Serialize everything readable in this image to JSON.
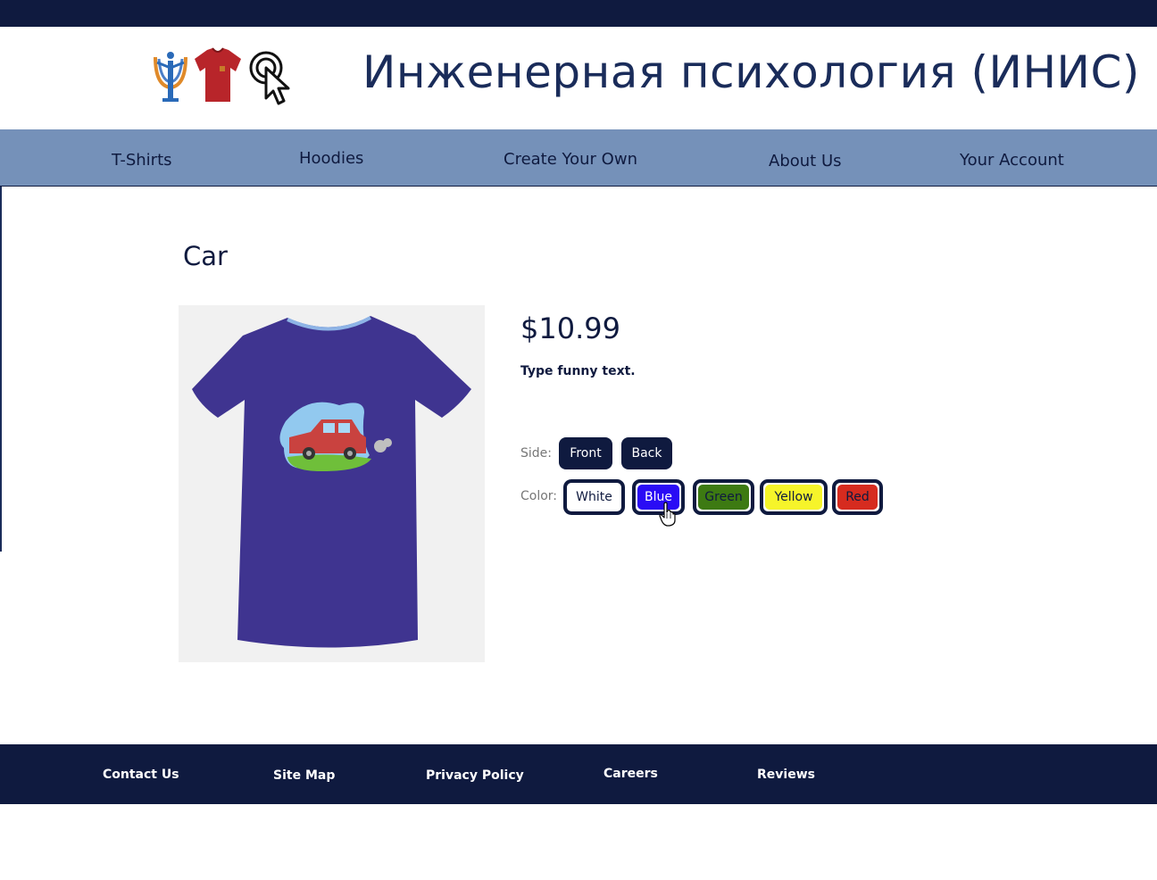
{
  "header": {
    "title": "Инженерная психология (ИНИС)"
  },
  "nav": {
    "items": [
      "T-Shirts",
      "Hoodies",
      "Create Your Own",
      "About Us",
      "Your Account"
    ]
  },
  "product": {
    "name": "Car",
    "price": "$10.99",
    "description": "Type funny text.",
    "image_icon": "t-shirt-car-image",
    "shirt_color": "#3f3490",
    "side_label": "Side:",
    "side_options": [
      "Front",
      "Back"
    ],
    "color_label": "Color:",
    "color_options": [
      {
        "label": "White",
        "color": "#ffffff",
        "text_color": "#0f1a3f"
      },
      {
        "label": "Blue",
        "color": "#2a0cf5",
        "text_color": "#ffffff"
      },
      {
        "label": "Green",
        "color": "#3d7a12",
        "text_color": "#0f1a3f"
      },
      {
        "label": "Yellow",
        "color": "#f6f42a",
        "text_color": "#0f1a3f"
      },
      {
        "label": "Red",
        "color": "#d62b1f",
        "text_color": "#0f1a3f"
      }
    ]
  },
  "footer": {
    "links": [
      "Contact Us",
      "Site Map",
      "Privacy Policy",
      "Careers",
      "Reviews"
    ]
  },
  "colors": {
    "navy": "#0f1a3f",
    "nav_bg": "#7591b9"
  }
}
